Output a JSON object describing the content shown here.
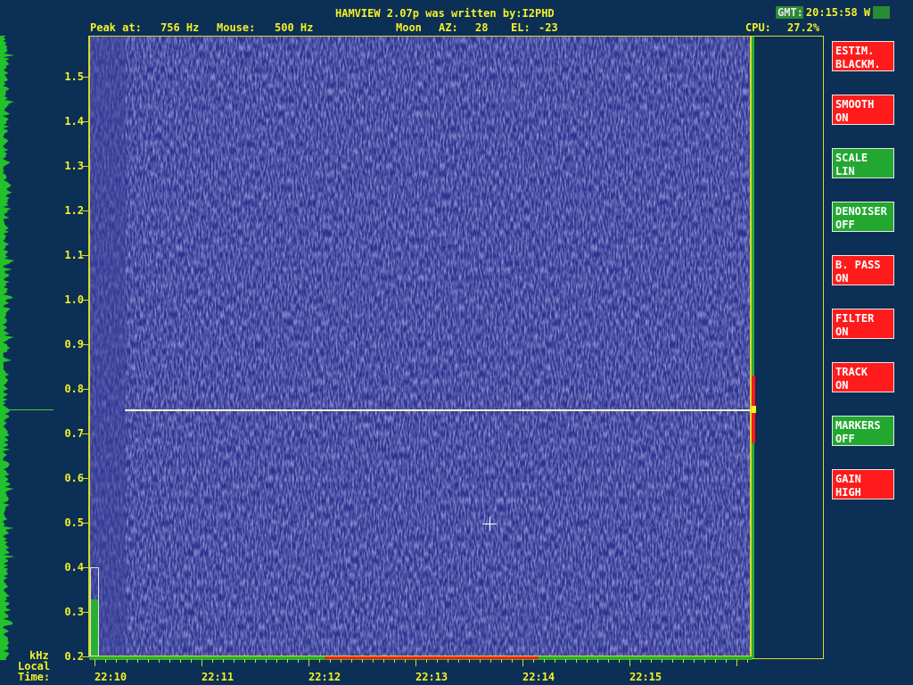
{
  "header": {
    "title": "HAMVIEW 2.07p was written by:I2PHD",
    "peak_label": "Peak at:",
    "peak_value": "756 Hz",
    "mouse_label": "Mouse:",
    "mouse_value": "500 Hz",
    "moon_label": "Moon",
    "az_label": "AZ:",
    "az_value": "28",
    "el_label": "EL:",
    "el_value": "-23",
    "cpu_label": "CPU:",
    "cpu_value": "27.2%",
    "gmt_label": "GMT:",
    "gmt_value": "20:15:58 W"
  },
  "freq_axis": {
    "unit": "kHz",
    "ticks": [
      "1.5",
      "1.4",
      "1.3",
      "1.2",
      "1.1",
      "1.0",
      "0.9",
      "0.8",
      "0.7",
      "0.6",
      "0.5",
      "0.4",
      "0.3",
      "0.2"
    ]
  },
  "time_axis": {
    "label_line1": "Local",
    "label_line2": "Time:",
    "ticks": [
      "22:10",
      "22:11",
      "22:12",
      "22:13",
      "22:14",
      "22:15"
    ]
  },
  "signal": {
    "peak_hz": 756,
    "mouse_hz": 500,
    "level_fraction": 0.64
  },
  "colors": {
    "background": "#0c2f55",
    "text": "#f2f226",
    "waterfall": "#303590",
    "button_red": "#ff1b1b",
    "button_green": "#22a830"
  },
  "buttons": [
    {
      "id": "estim",
      "line1": "ESTIM.",
      "line2": "BLACKM.",
      "color": "red"
    },
    {
      "id": "smooth",
      "line1": "SMOOTH",
      "line2": "ON",
      "color": "red"
    },
    {
      "id": "scale",
      "line1": "SCALE",
      "line2": "LIN",
      "color": "green"
    },
    {
      "id": "denoiser",
      "line1": "DENOISER",
      "line2": "OFF",
      "color": "green"
    },
    {
      "id": "bpass",
      "line1": "B. PASS",
      "line2": "ON",
      "color": "red"
    },
    {
      "id": "filter",
      "line1": "FILTER",
      "line2": "ON",
      "color": "red"
    },
    {
      "id": "track",
      "line1": "TRACK",
      "line2": "ON",
      "color": "red"
    },
    {
      "id": "markers",
      "line1": "MARKERS",
      "line2": "OFF",
      "color": "green"
    },
    {
      "id": "gain",
      "line1": "GAIN",
      "line2": "HIGH",
      "color": "red"
    }
  ]
}
